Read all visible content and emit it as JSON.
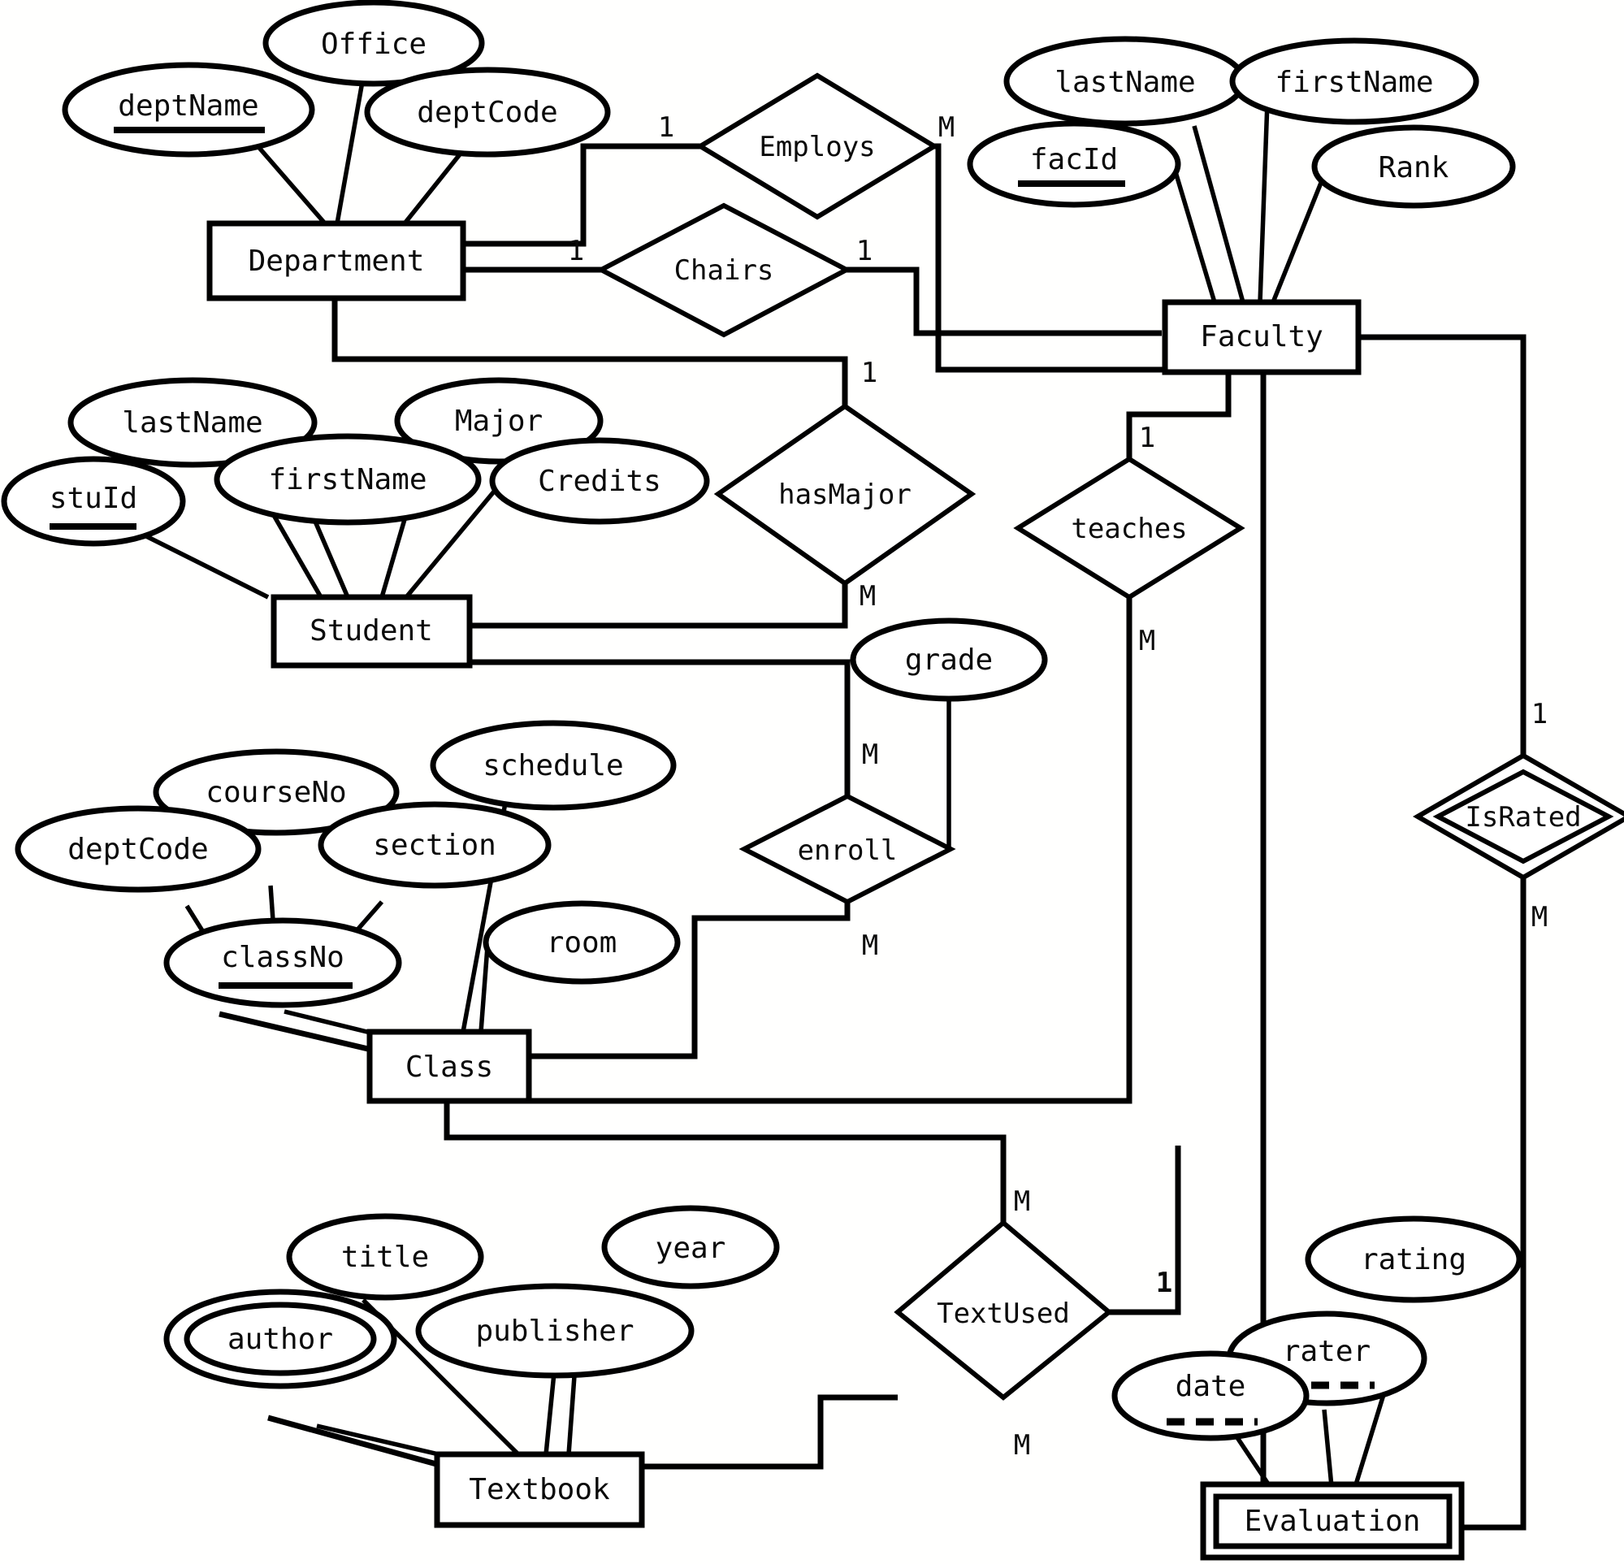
{
  "diagram": {
    "title": "University ER Diagram",
    "type": "entity-relationship-diagram",
    "notation": "Chen",
    "colors": {
      "stroke": "#000000",
      "fill": "#ffffff",
      "background": "#ffffff"
    }
  },
  "entities": [
    {
      "id": "department",
      "label": "Department",
      "kind": "strong"
    },
    {
      "id": "faculty",
      "label": "Faculty",
      "kind": "strong"
    },
    {
      "id": "student",
      "label": "Student",
      "kind": "strong"
    },
    {
      "id": "class",
      "label": "Class",
      "kind": "strong"
    },
    {
      "id": "textbook",
      "label": "Textbook",
      "kind": "strong"
    },
    {
      "id": "evaluation",
      "label": "Evaluation",
      "kind": "weak"
    }
  ],
  "relationships": [
    {
      "id": "employs",
      "label": "Employs",
      "kind": "regular",
      "left_card": "1",
      "right_card": "M"
    },
    {
      "id": "chairs",
      "label": "Chairs",
      "kind": "regular",
      "left_card": "1",
      "right_card": "1"
    },
    {
      "id": "hasmajor",
      "label": "hasMajor",
      "kind": "regular",
      "top_card": "1",
      "bottom_card": "M"
    },
    {
      "id": "teaches",
      "label": "teaches",
      "kind": "regular",
      "top_card": "1",
      "bottom_card": "M"
    },
    {
      "id": "enroll",
      "label": "enroll",
      "kind": "regular",
      "top_card": "M",
      "bottom_card": "M"
    },
    {
      "id": "textused",
      "label": "TextUsed",
      "kind": "regular",
      "top_card": "M",
      "bottom_card": "M",
      "right_card": "1"
    },
    {
      "id": "israted",
      "label": "IsRated",
      "kind": "identifying",
      "top_card": "1",
      "bottom_card": "M"
    }
  ],
  "attributes": [
    {
      "id": "deptname",
      "label": "deptName",
      "owner": "department",
      "key": "primary"
    },
    {
      "id": "office",
      "label": "Office",
      "owner": "department",
      "key": "none"
    },
    {
      "id": "deptcode_dept",
      "label": "deptCode",
      "owner": "department",
      "key": "none"
    },
    {
      "id": "fac_lastname",
      "label": "lastName",
      "owner": "faculty",
      "key": "none"
    },
    {
      "id": "fac_firstname",
      "label": "firstName",
      "owner": "faculty",
      "key": "none"
    },
    {
      "id": "facid",
      "label": "facId",
      "owner": "faculty",
      "key": "primary"
    },
    {
      "id": "rank",
      "label": "Rank",
      "owner": "faculty",
      "key": "none"
    },
    {
      "id": "stu_lastname",
      "label": "lastName",
      "owner": "student",
      "key": "none"
    },
    {
      "id": "stu_firstname",
      "label": "firstName",
      "owner": "student",
      "key": "none"
    },
    {
      "id": "stuid",
      "label": "stuId",
      "owner": "student",
      "key": "primary"
    },
    {
      "id": "major",
      "label": "Major",
      "owner": "student",
      "key": "none"
    },
    {
      "id": "credits",
      "label": "Credits",
      "owner": "student",
      "key": "none"
    },
    {
      "id": "courseno",
      "label": "courseNo",
      "owner": "class",
      "key": "none"
    },
    {
      "id": "schedule",
      "label": "schedule",
      "owner": "class",
      "key": "none"
    },
    {
      "id": "section",
      "label": "section",
      "owner": "class",
      "key": "none"
    },
    {
      "id": "cls_deptcode",
      "label": "deptCode",
      "owner": "class",
      "key": "none"
    },
    {
      "id": "classno",
      "label": "classNo",
      "owner": "class",
      "key": "primary"
    },
    {
      "id": "room",
      "label": "room",
      "owner": "class",
      "key": "none"
    },
    {
      "id": "grade",
      "label": "grade",
      "owner": "enroll",
      "key": "none"
    },
    {
      "id": "title",
      "label": "title",
      "owner": "textbook",
      "key": "none"
    },
    {
      "id": "year",
      "label": "year",
      "owner": "textbook",
      "key": "none"
    },
    {
      "id": "author",
      "label": "author",
      "owner": "textbook",
      "key": "multivalued"
    },
    {
      "id": "publisher",
      "label": "publisher",
      "owner": "textbook",
      "key": "none"
    },
    {
      "id": "rating",
      "label": "rating",
      "owner": "evaluation",
      "key": "none"
    },
    {
      "id": "rater",
      "label": "rater",
      "owner": "evaluation",
      "key": "partial"
    },
    {
      "id": "date",
      "label": "date",
      "owner": "evaluation",
      "key": "partial"
    }
  ],
  "cardinality_labels": {
    "employs_left": "1",
    "employs_right": "M",
    "chairs_left": "1",
    "chairs_right": "1",
    "hasmajor_top": "1",
    "hasmajor_bottom": "M",
    "teaches_top": "1",
    "teaches_bottom": "M",
    "enroll_top": "M",
    "enroll_bottom": "M",
    "israted_top": "1",
    "israted_bottom": "M",
    "textused_top": "M",
    "textused_bottom": "M",
    "textused_right": "1"
  }
}
